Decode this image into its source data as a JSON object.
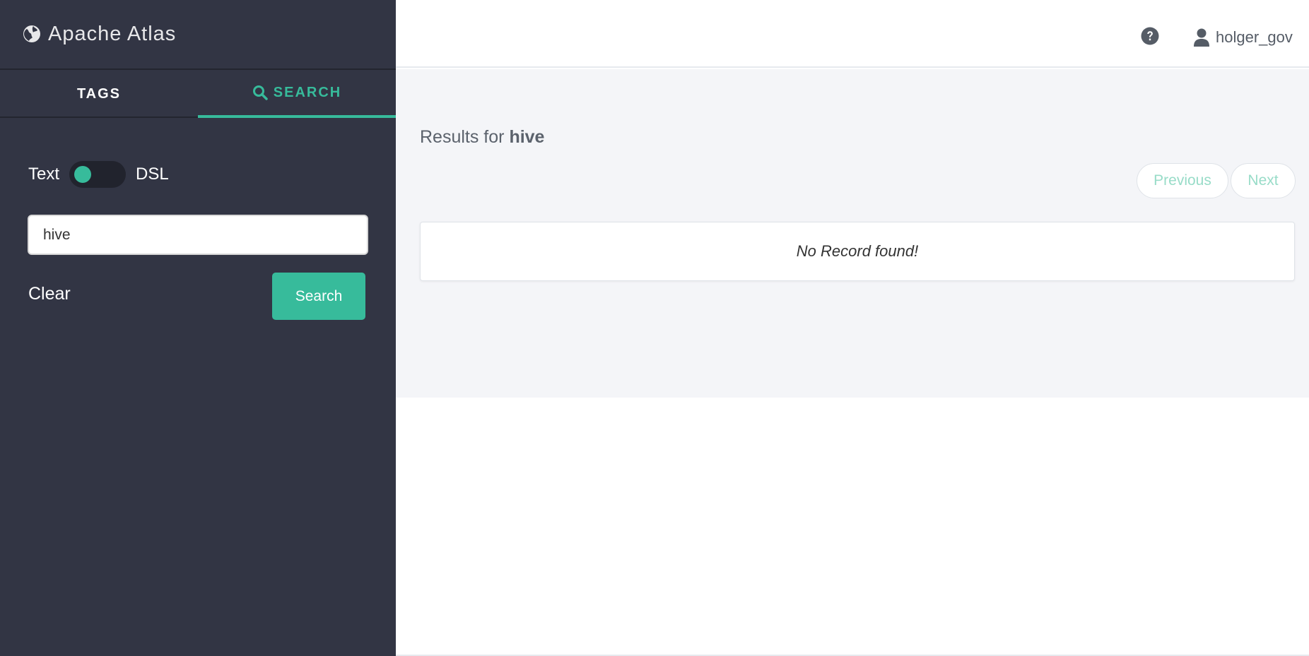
{
  "colors": {
    "sidebar_bg": "#323544",
    "accent": "#37bb9b",
    "main_bg": "#f4f5f8"
  },
  "brand": {
    "title": "Apache Atlas",
    "icon": "globe-icon"
  },
  "tabs": [
    {
      "label": "TAGS",
      "active": false
    },
    {
      "label": "SEARCH",
      "active": true,
      "icon": "search-icon"
    }
  ],
  "search": {
    "mode_left": "Text",
    "mode_right": "DSL",
    "mode_selected": "Text",
    "query_value": "hive",
    "clear_label": "Clear",
    "button_label": "Search"
  },
  "header": {
    "help_icon": "question-circle-icon",
    "user_icon": "user-icon",
    "username": "holger_gov"
  },
  "results": {
    "prefix": "Results for",
    "query": "hive",
    "previous_label": "Previous",
    "next_label": "Next",
    "empty_message": "No Record found!"
  }
}
